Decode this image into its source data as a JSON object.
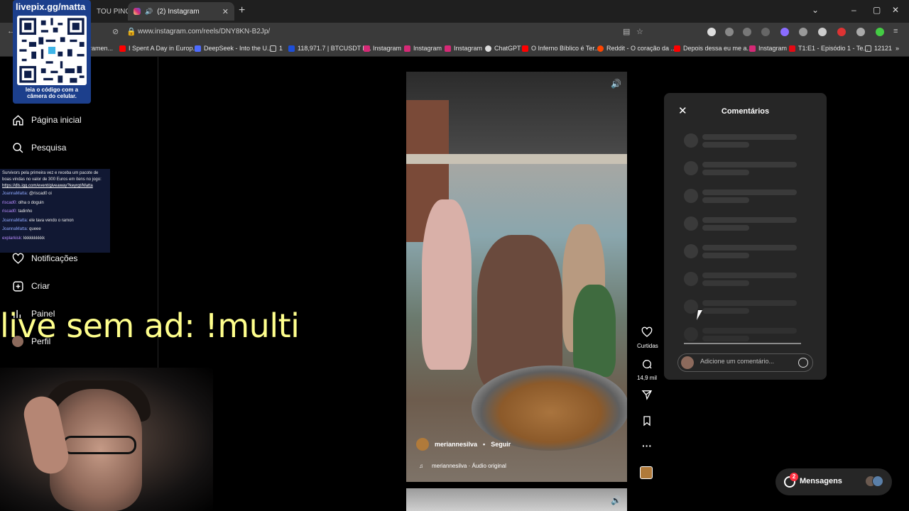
{
  "browser": {
    "tabs": [
      {
        "label": "TOU PINC"
      },
      {
        "label": "(2) Instagram"
      }
    ],
    "url": "www.instagram.com/reels/DNY8KN-B2Jp/",
    "bookmarks": [
      {
        "label": "ramen..."
      },
      {
        "label": "I Spent A Day in Europ..."
      },
      {
        "label": "DeepSeek - Into the U..."
      },
      {
        "label": "1"
      },
      {
        "label": "118,971.7 | BTCUSDT P..."
      },
      {
        "label": "Instagram"
      },
      {
        "label": "Instagram"
      },
      {
        "label": "Instagram"
      },
      {
        "label": "ChatGPT"
      },
      {
        "label": "O Inferno Bíblico é Ter..."
      },
      {
        "label": "Reddit - O coração da ..."
      },
      {
        "label": "Depois dessa eu me a..."
      },
      {
        "label": "Instagram"
      },
      {
        "label": "T1:E1 - Episódio 1 - Te..."
      },
      {
        "label": "12121"
      }
    ]
  },
  "stream": {
    "qr_title": "livepix.gg/matta",
    "qr_caption_line1": "leia o código com a",
    "qr_caption_line2": "câmera do celular.",
    "banner": "live sem ad: !multi",
    "chat": {
      "intro": "Survivors pela primeira vez e receba um pacote de boas vindas no valor de 300 Euros em itens no jogo:",
      "link": "https://dls.igg.com/event/giveaway?keyrgt/Matta",
      "messages": [
        {
          "user": "JoannaMatta:",
          "text": "@riscad0 oi"
        },
        {
          "user": "riscad0:",
          "text": "olha o doguin"
        },
        {
          "user": "riscad0:",
          "text": "tadinho"
        },
        {
          "user": "JoannaMatta:",
          "text": "ele tava vendo o ramon"
        },
        {
          "user": "JoannaMatta:",
          "text": "queee"
        },
        {
          "user": "explarkisk:",
          "text": "kkkkkkkkkk"
        }
      ]
    }
  },
  "sidebar": {
    "items": [
      {
        "label": "Página inicial",
        "icon": "home-icon"
      },
      {
        "label": "Pesquisa",
        "icon": "search-icon"
      },
      {
        "label": "Notificações",
        "icon": "heart-icon"
      },
      {
        "label": "Criar",
        "icon": "plus-square-icon"
      },
      {
        "label": "Painel",
        "icon": "dashboard-icon"
      },
      {
        "label": "Perfil",
        "icon": "avatar-icon"
      }
    ]
  },
  "reel": {
    "author": "meriannesilva",
    "separator": "•",
    "follow_label": "Seguir",
    "audio": "meriannesilva · Áudio original",
    "likes_label": "Curtidas",
    "comments_count": "14,9 mil"
  },
  "comments_panel": {
    "title": "Comentários",
    "input_placeholder": "Adicione um comentário..."
  },
  "messages": {
    "label": "Mensagens",
    "badge": "2"
  },
  "colors": {
    "background": "#000000",
    "panel": "#262626",
    "banner_text": "#ffff8c",
    "notification": "#ff3040"
  }
}
